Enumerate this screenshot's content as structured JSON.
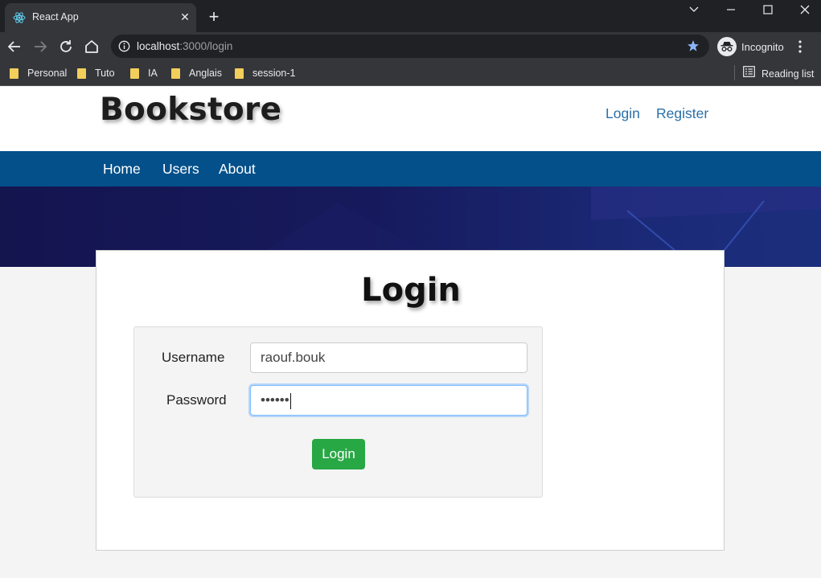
{
  "browser": {
    "tab_title": "React App",
    "url_host": "localhost",
    "url_rest": ":3000/login",
    "profile_label": "Incognito",
    "bookmarks": [
      "Personal",
      "Tuto",
      "IA",
      "Anglais",
      "session-1"
    ],
    "reading_list_label": "Reading list",
    "tab_favicon": "react-icon",
    "accent_color": "#8ab4f8"
  },
  "site": {
    "brand": "Bookstore",
    "auth_links": {
      "login": "Login",
      "register": "Register"
    },
    "nav_items": [
      "Home",
      "Users",
      "About"
    ],
    "nav_color": "#03508a",
    "hero_color": "#14144f"
  },
  "login": {
    "title": "Login",
    "username_label": "Username",
    "username_value": "raouf.bouk",
    "password_label": "Password",
    "password_value": "••••••",
    "submit_label": "Login",
    "submit_color": "#28a745"
  }
}
